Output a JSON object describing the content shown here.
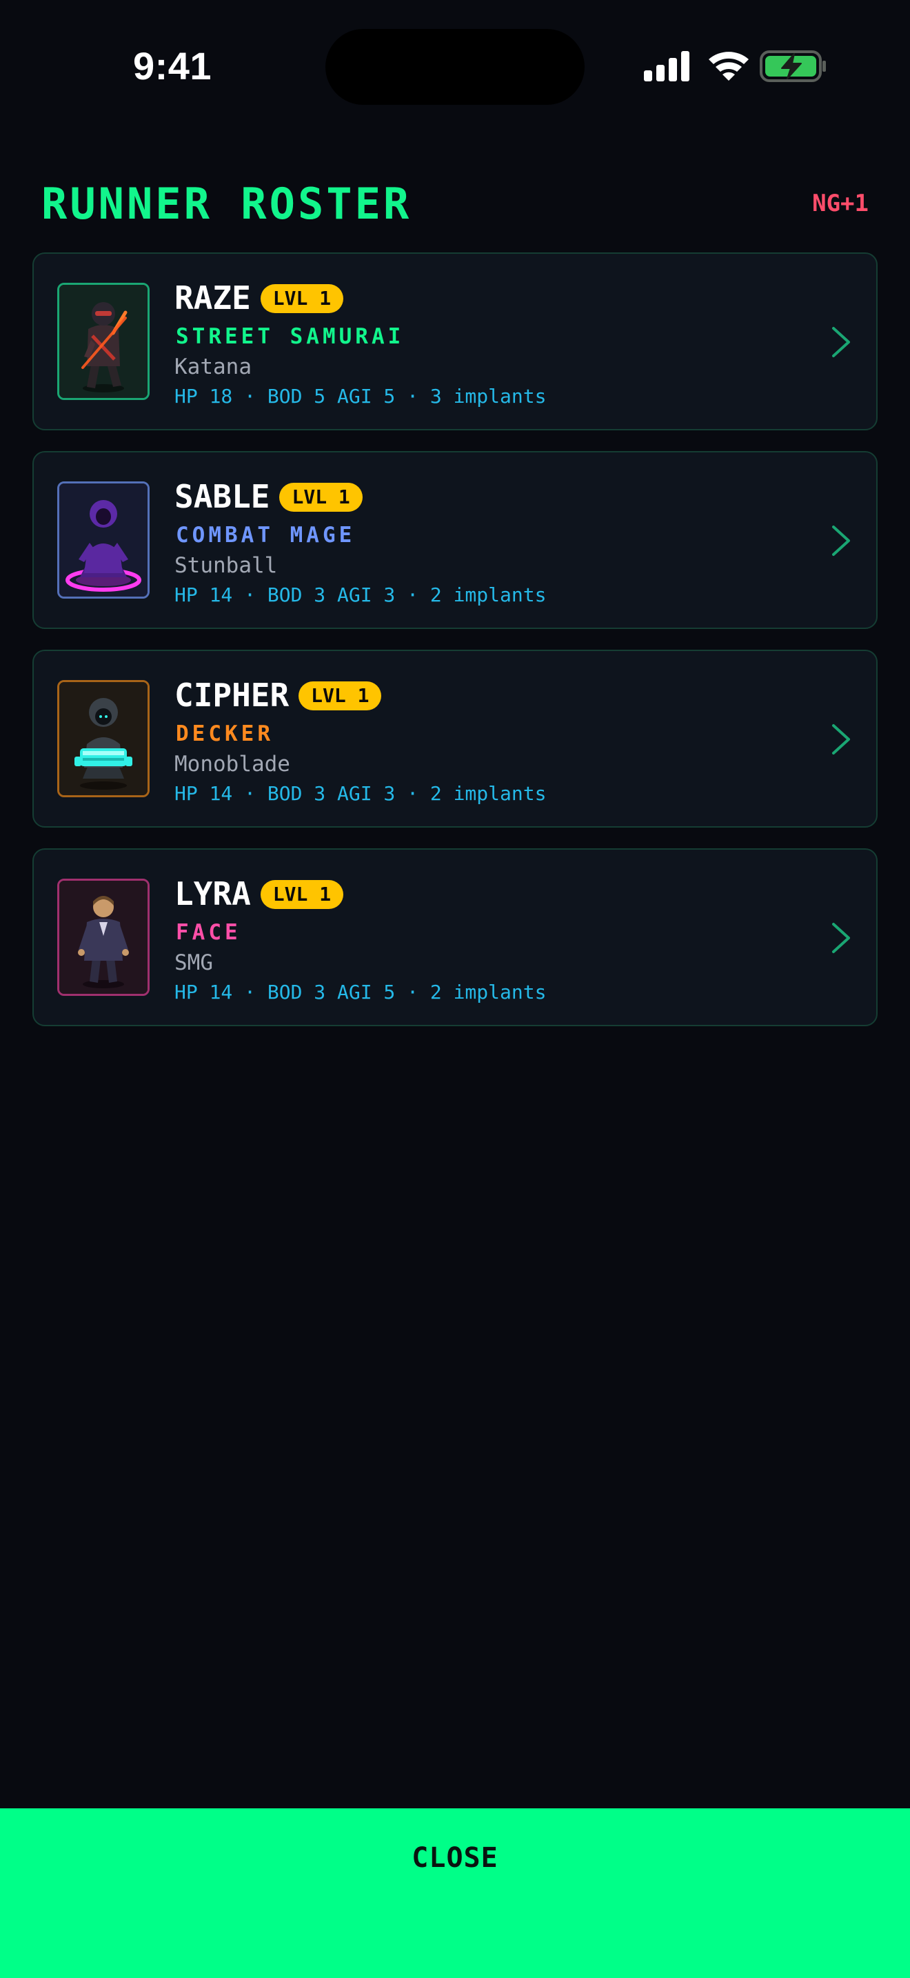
{
  "status_bar": {
    "time": "9:41"
  },
  "header": {
    "title": "RUNNER ROSTER",
    "badge": "NG+1",
    "title_color": "#12f58c",
    "badge_color": "#ff4d6b"
  },
  "runners": [
    {
      "name": "RAZE",
      "level": "LVL 1",
      "class": "STREET SAMURAI",
      "class_color": "#12f58c",
      "weapon": "Katana",
      "stats": "HP 18 · BOD 5 AGI 5 · 3 implants",
      "portrait_icon": "samurai-portrait-icon"
    },
    {
      "name": "SABLE",
      "level": "LVL 1",
      "class": "COMBAT MAGE",
      "class_color": "#6f96ff",
      "weapon": "Stunball",
      "stats": "HP 14 · BOD 3 AGI 3 · 2 implants",
      "portrait_icon": "mage-portrait-icon"
    },
    {
      "name": "CIPHER",
      "level": "LVL 1",
      "class": "DECKER",
      "class_color": "#ff8a1f",
      "weapon": "Monoblade",
      "stats": "HP 14 · BOD 3 AGI 3 · 2 implants",
      "portrait_icon": "decker-portrait-icon"
    },
    {
      "name": "LYRA",
      "level": "LVL 1",
      "class": "FACE",
      "class_color": "#ff4fa8",
      "weapon": "SMG",
      "stats": "HP 14 · BOD 3 AGI 5 · 2 implants",
      "portrait_icon": "face-portrait-icon"
    }
  ],
  "footer": {
    "close_label": "CLOSE",
    "button_color": "#00ff88"
  },
  "icons": {
    "card_chevron": "chevron-right-icon",
    "signal": "cellular-signal-icon",
    "wifi": "wifi-icon",
    "battery": "battery-charging-icon"
  }
}
